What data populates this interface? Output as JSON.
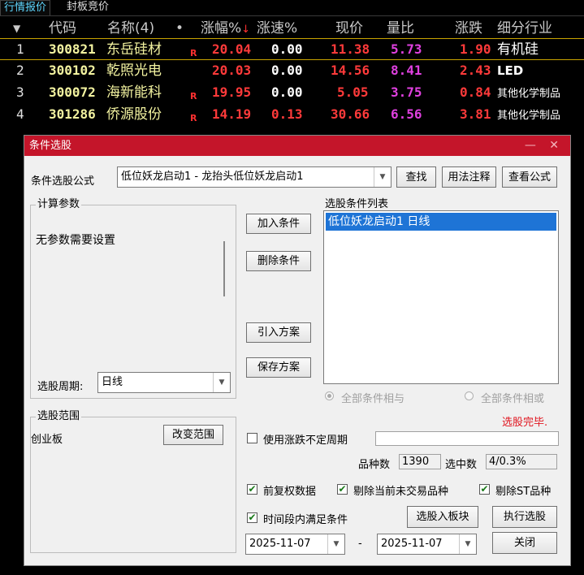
{
  "tabs": [
    {
      "label": "行情报价"
    },
    {
      "label": "封板竞价"
    }
  ],
  "table": {
    "headers": {
      "sort_glyph": "▼",
      "code": "代码",
      "name": "名称(4)",
      "dot": "•",
      "change_pct": "涨幅%",
      "change_pct_sort": "↓",
      "speed": "涨速%",
      "price": "现价",
      "volume_ratio": "量比",
      "change": "涨跌",
      "industry": "细分行业"
    },
    "rows": [
      {
        "no": "1",
        "code": "300821",
        "name": "东岳硅材",
        "flag": "R",
        "change_pct": "20.04",
        "speed": "0.00",
        "price": "11.38",
        "volume_ratio": "5.73",
        "change": "1.90",
        "industry": "有机硅"
      },
      {
        "no": "2",
        "code": "300102",
        "name": "乾照光电",
        "flag": "",
        "change_pct": "20.03",
        "speed": "0.00",
        "price": "14.56",
        "volume_ratio": "8.41",
        "change": "2.43",
        "industry": "LED"
      },
      {
        "no": "3",
        "code": "300072",
        "name": "海新能科",
        "flag": "R",
        "change_pct": "19.95",
        "speed": "0.00",
        "price": "5.05",
        "volume_ratio": "3.75",
        "change": "0.84",
        "industry": "其他化学制品"
      },
      {
        "no": "4",
        "code": "301286",
        "name": "侨源股份",
        "flag": "R",
        "change_pct": "14.19",
        "speed": "0.13",
        "price": "30.66",
        "volume_ratio": "6.56",
        "change": "3.81",
        "industry": "其他化学制品"
      }
    ]
  },
  "dialog": {
    "title": "条件选股",
    "window_controls": "— ✕",
    "formula_label": "条件选股公式",
    "formula_value": "低位妖龙启动1  -  龙抬头低位妖龙启动1",
    "find_button": "查找",
    "usage_button": "用法注释",
    "view_formula_button": "查看公式",
    "calc_params_title": "计算参数",
    "no_params_text": "无参数需要设置",
    "period_label": "选股周期:",
    "period_value": "日线",
    "add_condition_button": "加入条件",
    "delete_condition_button": "删除条件",
    "import_scheme_button": "引入方案",
    "save_scheme_button": "保存方案",
    "condition_list_title": "选股条件列表",
    "conditions": [
      "低位妖龙启动1  日线"
    ],
    "radio_and": "全部条件相与",
    "radio_or": "全部条件相或",
    "status_text": "选股完毕.",
    "range_title": "选股范围",
    "range_value": "创业板",
    "change_range_button": "改变范围",
    "uncertain_period_label": "使用涨跌不定周期",
    "count_label": "品种数",
    "count_value": "1390",
    "selected_label": "选中数",
    "selected_value": "4/0.3%",
    "forward_adjust_label": "前复权数据",
    "exclude_untraded_label": "剔除当前未交易品种",
    "exclude_st_label": "剔除ST品种",
    "time_range_label": "时间段内满足条件",
    "add_to_block_button": "选股入板块",
    "execute_button": "执行选股",
    "date_from": "2025-11-07",
    "date_sep": "-",
    "date_to": "2025-11-07",
    "close_button": "关闭",
    "check_mark": "✔",
    "combo_arrow": "▼"
  },
  "colors": {
    "title_bar": "#c4152a",
    "selection": "#1e74d6",
    "status_red": "#e0141e",
    "quote_red": "#ff3a3a",
    "quote_magenta": "#e040e0",
    "quote_yellow": "#f3f3a0"
  }
}
